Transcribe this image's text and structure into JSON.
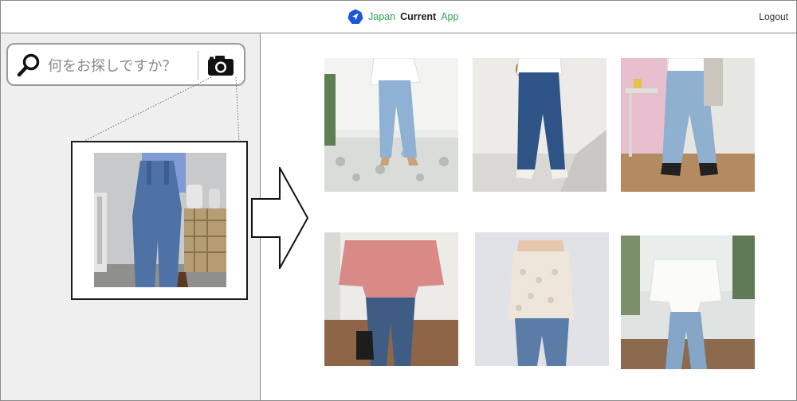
{
  "header": {
    "brand": {
      "word1": "Japan",
      "word2": "Current",
      "word3": "App"
    },
    "logout_label": "Logout",
    "accent_color": "#2da44e",
    "logo_color": "#1a56d8"
  },
  "search": {
    "placeholder": "何をお探しですか？",
    "icon": "search-icon",
    "camera_icon": "camera-icon"
  },
  "query_image": {
    "subject": "denim overalls over blue shirt"
  },
  "arrow_icon": "right-arrow-icon",
  "results": [
    {
      "subject": "light ripped jeans, white blouse"
    },
    {
      "subject": "flared dark jeans"
    },
    {
      "subject": "wide light jeans, white top"
    },
    {
      "subject": "pink t-shirt with jeans"
    },
    {
      "subject": "lace camisole with jeans"
    },
    {
      "subject": "white ruffle top with jeans"
    }
  ]
}
